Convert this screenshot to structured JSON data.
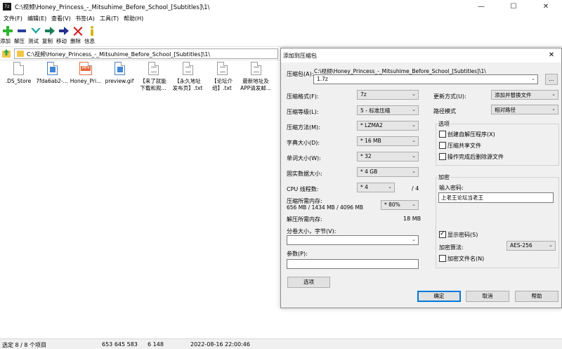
{
  "window": {
    "app_icon_text": "7z",
    "title": "C:\\视频\\Honey_Princess_-_Mitsuhime_Before_School_[Subtitles]\\1\\",
    "minimize": "—",
    "maximize": "☐",
    "close": "✕"
  },
  "menu": [
    "文件(F)",
    "编辑(E)",
    "查看(V)",
    "书签(A)",
    "工具(T)",
    "帮助(H)"
  ],
  "toolbar": [
    {
      "label": "添加",
      "icon": "add-icon",
      "color": "#2fb52f"
    },
    {
      "label": "解压",
      "icon": "extract-icon",
      "color": "#2b3fa0"
    },
    {
      "label": "测试",
      "icon": "test-icon",
      "color": "#1aa6a6"
    },
    {
      "label": "复制",
      "icon": "copy-icon",
      "color": "#1a7d5a"
    },
    {
      "label": "移动",
      "icon": "move-icon",
      "color": "#22308e"
    },
    {
      "label": "删除",
      "icon": "delete-icon",
      "color": "#d02020"
    },
    {
      "label": "信息",
      "icon": "info-icon",
      "color": "#d6b51a"
    }
  ],
  "address": {
    "path": "C:\\视频\\Honey_Princess_-_Mitsuhime_Before_School_[Subtitles]\\1\\"
  },
  "files": [
    {
      "name": ".DS_Store",
      "type": "blank"
    },
    {
      "name": "7fda6ab2-...",
      "type": "img"
    },
    {
      "name": "Honey_Pri...",
      "type": "mp4"
    },
    {
      "name": "preview.gif",
      "type": "img"
    },
    {
      "name": "【来了就能\n下载和观...",
      "type": "txt"
    },
    {
      "name": "【永久地址\n发布页】.txt",
      "type": "txt"
    },
    {
      "name": "【论坛介\n绍】.txt",
      "type": "txt"
    },
    {
      "name": "最新地址及\nAPP请发邮...",
      "type": "txt"
    }
  ],
  "status": {
    "selection": "选定 8 / 8 个项目",
    "size": "653 645 583",
    "packed": "6 148",
    "date": "2022-08-16 22:00:46"
  },
  "dialog": {
    "title": "添加到压缩包",
    "close": "✕",
    "archive_label": "压缩包(A):",
    "archive_dir": "C:\\视频\\Honey_Princess_-_Mitsuhime_Before_School_[Subtitles]\\1\\",
    "archive_name": "1.7z",
    "browse": "...",
    "format_label": "压缩格式(F):",
    "format_value": "7z",
    "level_label": "压缩等级(L):",
    "level_value": "5 - 标准压缩",
    "method_label": "压缩方法(M):",
    "method_value": "* LZMA2",
    "dict_label": "字典大小(D):",
    "dict_value": "* 16 MB",
    "word_label": "单词大小(W):",
    "word_value": "* 32",
    "solid_label": "固实数据大小:",
    "solid_value": "* 4 GB",
    "threads_label": "CPU 线程数:",
    "threads_value": "* 4",
    "threads_total": "/ 4",
    "mem_comp_label": "压缩所需内存:",
    "mem_comp_detail": "656 MB / 1434 MB / 4096 MB",
    "mem_comp_value": "* 80%",
    "mem_decomp_label": "解压所需内存:",
    "mem_decomp_value": "18 MB",
    "split_label": "分卷大小，字节(V):",
    "split_value": "",
    "params_label": "参数(P):",
    "params_value": "",
    "options_button": "选项",
    "update_label": "更新方式(U):",
    "update_value": "添加并替换文件",
    "path_label": "路径模式",
    "path_value": "相对路径",
    "options_group": "选项",
    "opt_sfx": "创建自解压程序(X)",
    "opt_shared": "压缩共享文件",
    "opt_delete": "操作完成后删除源文件",
    "encrypt_group": "加密",
    "password_label": "输入密码:",
    "password_value": "上老王论坛当老王",
    "show_password": "显示密码(S)",
    "enc_method_label": "加密算法:",
    "enc_method_value": "AES-256",
    "encrypt_names": "加密文件名(N)",
    "ok": "确定",
    "cancel": "取消",
    "help": "帮助"
  }
}
